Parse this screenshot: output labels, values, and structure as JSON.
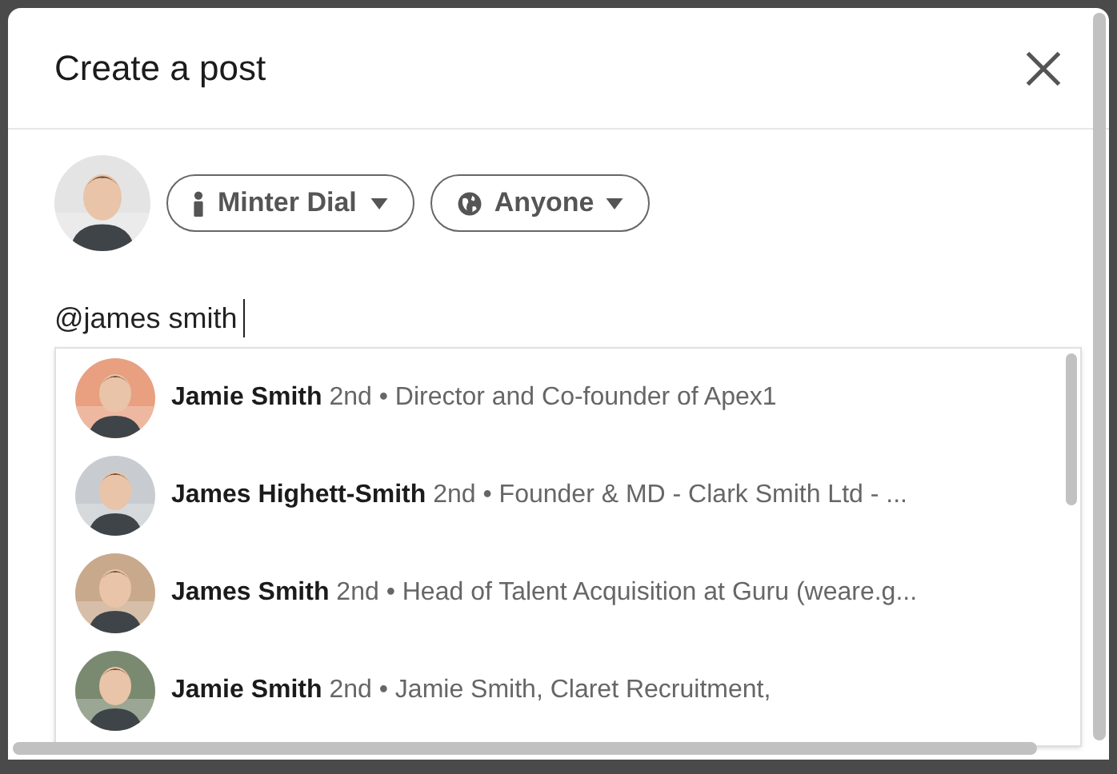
{
  "modal": {
    "title": "Create a post"
  },
  "author": {
    "name": "Minter Dial"
  },
  "audience": {
    "label": "Anyone"
  },
  "composer": {
    "value": "@james smith"
  },
  "suggestions": [
    {
      "name": "Jamie Smith",
      "degree": "2nd",
      "headline": "• Director and Co-founder of Apex1"
    },
    {
      "name": "James Highett-Smith",
      "degree": "2nd",
      "headline": "• Founder & MD - Clark Smith Ltd - ..."
    },
    {
      "name": "James Smith",
      "degree": "2nd",
      "headline": "• Head of Talent Acquisition at Guru (weare.g..."
    },
    {
      "name": "Jamie Smith",
      "degree": "2nd",
      "headline": "• Jamie Smith, Claret Recruitment,"
    }
  ]
}
